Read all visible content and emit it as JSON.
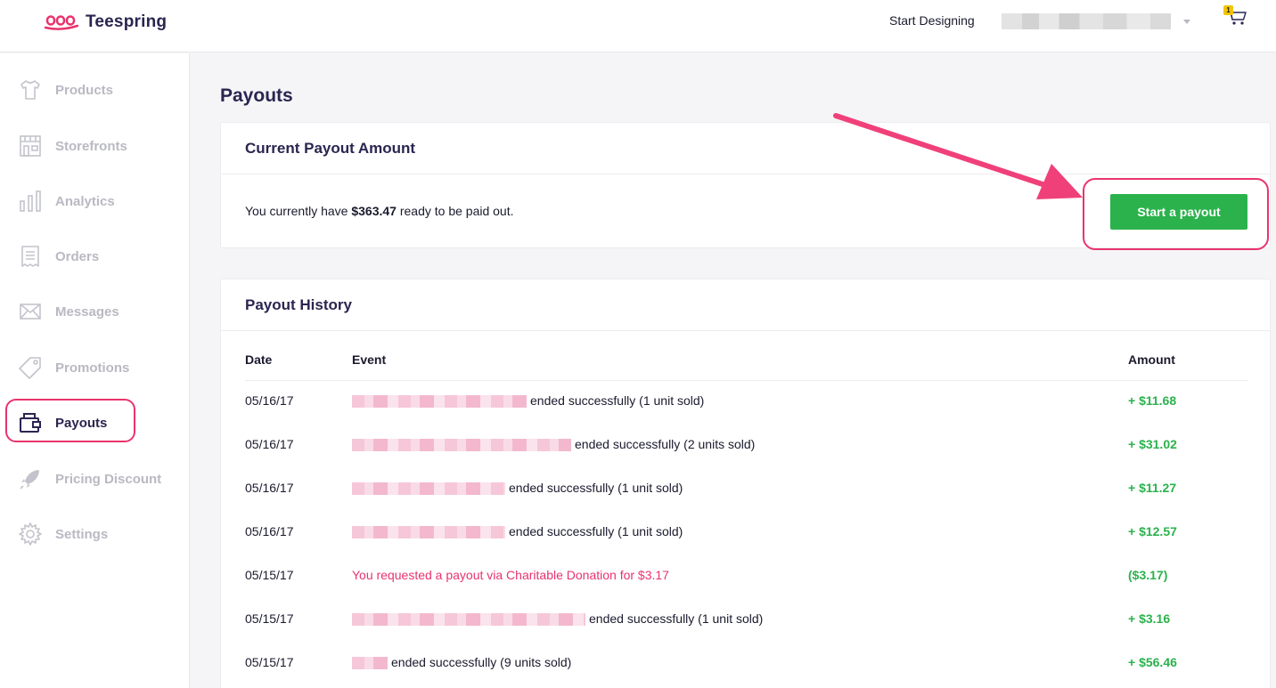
{
  "header": {
    "brand": "Teespring",
    "start_designing": "Start Designing",
    "cart_count": "1",
    "colors": {
      "brand": "#e9336d",
      "brand_text": "#2a2550"
    }
  },
  "sidebar": {
    "items": [
      {
        "label": "Products",
        "icon": "tshirt-icon",
        "active": false
      },
      {
        "label": "Storefronts",
        "icon": "storefront-icon",
        "active": false
      },
      {
        "label": "Analytics",
        "icon": "bar-chart-icon",
        "active": false
      },
      {
        "label": "Orders",
        "icon": "receipt-icon",
        "active": false
      },
      {
        "label": "Messages",
        "icon": "envelope-icon",
        "active": false
      },
      {
        "label": "Promotions",
        "icon": "tag-icon",
        "active": false
      },
      {
        "label": "Payouts",
        "icon": "wallet-icon",
        "active": true
      },
      {
        "label": "Pricing Discount",
        "icon": "rocket-icon",
        "active": false
      },
      {
        "label": "Settings",
        "icon": "gear-icon",
        "active": false
      }
    ]
  },
  "page": {
    "title": "Payouts",
    "current": {
      "heading": "Current Payout Amount",
      "text_before": "You currently have ",
      "amount": "$363.47",
      "text_after": " ready to be paid out.",
      "button_label": "Start a payout",
      "button_color": "#2bb24c"
    },
    "history": {
      "heading": "Payout History",
      "columns": {
        "date": "Date",
        "event": "Event",
        "amount": "Amount"
      },
      "rows": [
        {
          "date": "05/16/17",
          "event": "ended successfully (1 unit sold)",
          "amount": "+ $11.68",
          "blurred": true,
          "highlight": false
        },
        {
          "date": "05/16/17",
          "event": "ended successfully (2 units sold)",
          "amount": "+ $31.02",
          "blurred": true,
          "highlight": false
        },
        {
          "date": "05/16/17",
          "event": "ended successfully (1 unit sold)",
          "amount": "+ $11.27",
          "blurred": true,
          "highlight": false
        },
        {
          "date": "05/16/17",
          "event": "ended successfully (1 unit sold)",
          "amount": "+ $12.57",
          "blurred": true,
          "highlight": false
        },
        {
          "date": "05/15/17",
          "event": "You requested a payout via Charitable Donation for $3.17",
          "amount": "($3.17)",
          "blurred": false,
          "highlight": true
        },
        {
          "date": "05/15/17",
          "event": "ended successfully (1 unit sold)",
          "amount": "+ $3.16",
          "blurred": true,
          "highlight": false
        },
        {
          "date": "05/15/17",
          "event": "ended successfully (9 units sold)",
          "amount": "+ $56.46",
          "blurred": true,
          "highlight": false
        }
      ]
    }
  }
}
